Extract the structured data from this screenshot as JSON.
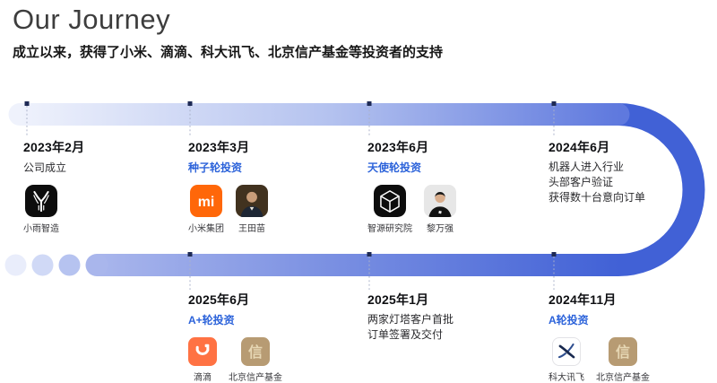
{
  "header": {
    "title": "Our Journey",
    "subtitle": "成立以来，获得了小米、滴滴、科大讯飞、北京信产基金等投资者的支持"
  },
  "timeline": {
    "top": [
      {
        "date": "2023年2月",
        "label": "公司成立",
        "accent": false,
        "logos": [
          {
            "icon": "xiaoyu",
            "label": "小雨智造"
          }
        ]
      },
      {
        "date": "2023年3月",
        "label": "种子轮投资",
        "accent": true,
        "logos": [
          {
            "icon": "xiaomi",
            "label": "小米集团"
          },
          {
            "icon": "wang",
            "label": "王田苗"
          }
        ]
      },
      {
        "date": "2023年6月",
        "label": "天使轮投资",
        "accent": true,
        "logos": [
          {
            "icon": "baai",
            "label": "智源研究院"
          },
          {
            "icon": "li",
            "label": "黎万强"
          }
        ]
      },
      {
        "date": "2024年6月",
        "lines": [
          "机器人进入行业",
          "头部客户验证",
          "获得数十台意向订单"
        ]
      }
    ],
    "bottom": [
      {
        "date": "2025年6月",
        "label": "A+轮投资",
        "accent": true,
        "logos": [
          {
            "icon": "didi",
            "label": "滴滴"
          },
          {
            "icon": "fund",
            "label": "北京信产基金"
          }
        ]
      },
      {
        "date": "2025年1月",
        "lines": [
          "两家灯塔客户首批",
          "订单签署及交付"
        ]
      },
      {
        "date": "2024年11月",
        "label": "A轮投资",
        "accent": true,
        "logos": [
          {
            "icon": "iflytek",
            "label": "科大讯飞"
          },
          {
            "icon": "fund",
            "label": "北京信产基金"
          }
        ]
      }
    ]
  },
  "colors": {
    "accent": "#2c63da",
    "band_light": "#eff2fc",
    "band_mid": "#b4c2ef",
    "band_end": "#5f79de",
    "bottom_start": "#a9b6ec",
    "bottom_end": "#4161d6",
    "dot1": "#e9edfb",
    "dot2": "#d0d9f6",
    "dot3": "#b6c3f0",
    "marker": "#1e2a55",
    "connector": "#aab1c8",
    "xiaomi_orange": "#ff6709",
    "didi_orange": "#ff7243",
    "fund_tan": "#b79b73",
    "logo_black": "#0d0d0d",
    "iflytek_navy": "#17284e"
  }
}
